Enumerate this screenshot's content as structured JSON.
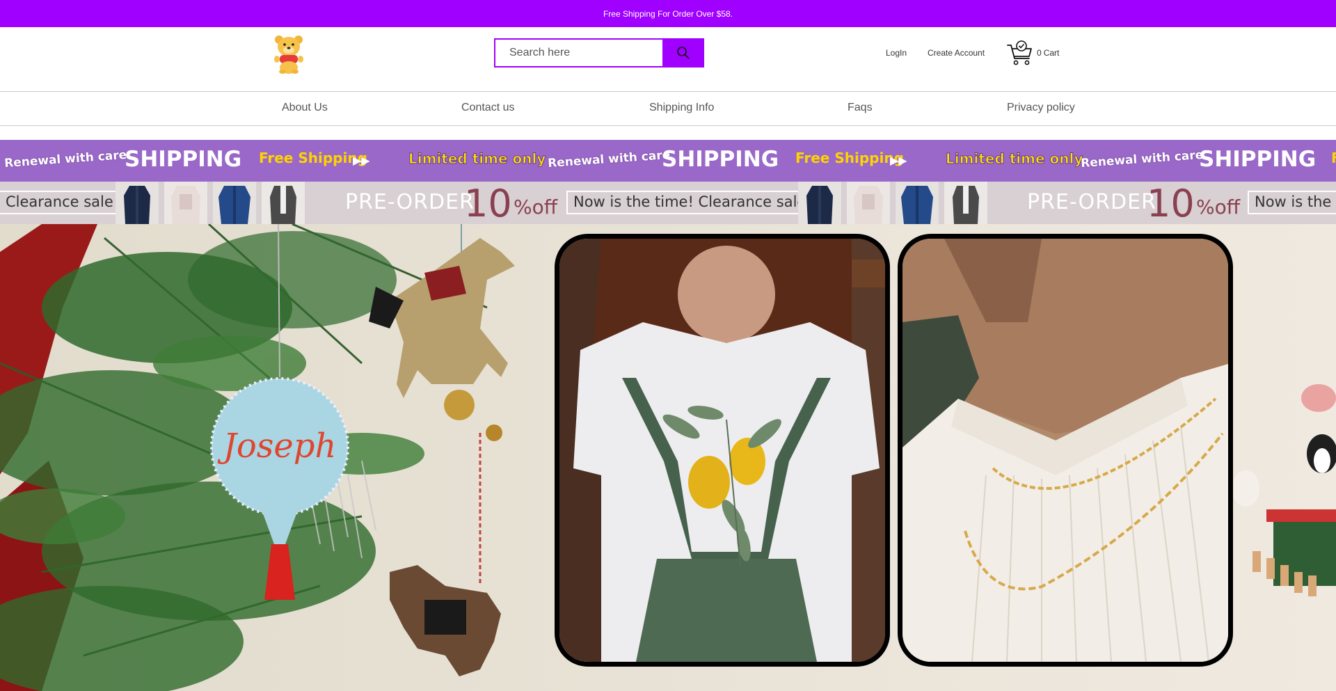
{
  "announcement": {
    "text": "Free Shipping For Order Over $58."
  },
  "header": {
    "logo_name": "bear-mascot-logo",
    "search": {
      "placeholder": "Search here",
      "value": ""
    },
    "login_label": "LogIn",
    "create_account_label": "Create Account",
    "cart_count": "0",
    "cart_label": "Cart"
  },
  "nav": {
    "items": [
      {
        "label": "About Us"
      },
      {
        "label": "Contact us"
      },
      {
        "label": "Shipping Info"
      },
      {
        "label": "Faqs"
      },
      {
        "label": "Privacy policy"
      }
    ]
  },
  "promo_banner_1": {
    "renewal": "Renewal with care",
    "shipping": "SHIPPING",
    "free_shipping": "Free Shipping",
    "limited": "Limited time only"
  },
  "promo_banner_2": {
    "clearance_short": "Clearance sale",
    "preorder": "PRE-ORDER",
    "discount_number": "10",
    "discount_suffix": "%off",
    "now_clearance": "Now is the time! Clearance sale",
    "now_partial": "Now is the t"
  },
  "hero": {
    "ornament_text": "Joseph"
  },
  "colors": {
    "brand_purple": "#a000ff",
    "banner_purple": "#9a68c8",
    "banner_gray": "#d8d0d2"
  }
}
